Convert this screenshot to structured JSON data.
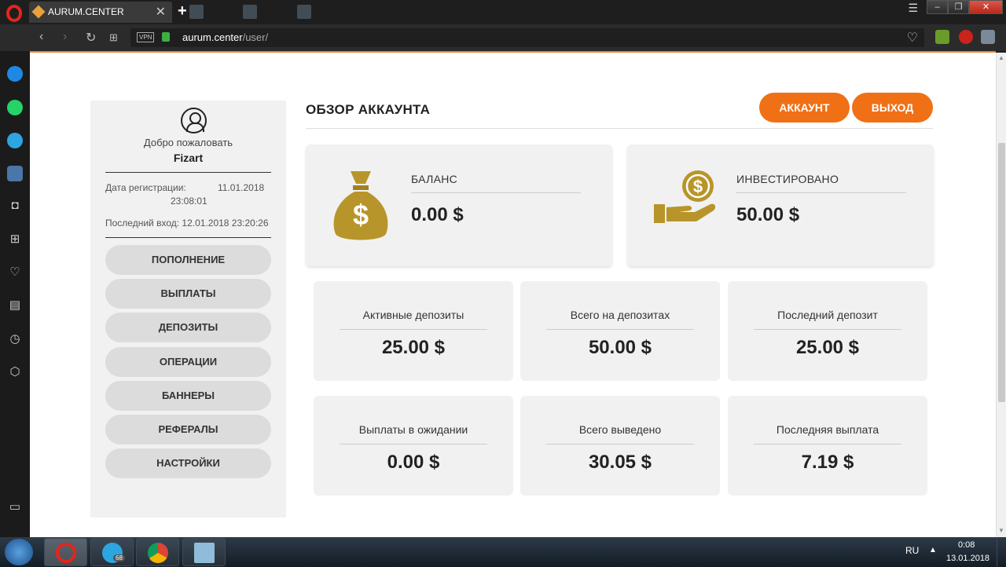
{
  "browser": {
    "tab_title": "AURUM.CENTER",
    "tab_close": "✕",
    "new_tab": "+",
    "vpn": "VPN",
    "url_domain": "aurum.center",
    "url_path": "/user/"
  },
  "profile": {
    "welcome": "Добро пожаловать",
    "username": "Fizart",
    "reg_label": "Дата регистрации:",
    "reg_date": "11.01.2018",
    "reg_time": "23:08:01",
    "last_login": "Последний вход: 12.01.2018 23:20:26"
  },
  "menu": [
    {
      "label": "ПОПОЛНЕНИЕ"
    },
    {
      "label": "ВЫПЛАТЫ"
    },
    {
      "label": "ДЕПОЗИТЫ"
    },
    {
      "label": "ОПЕРАЦИИ"
    },
    {
      "label": "БАННЕРЫ"
    },
    {
      "label": "РЕФЕРАЛЫ"
    },
    {
      "label": "НАСТРОЙКИ"
    }
  ],
  "header": {
    "title": "ОБЗОР АККАУНТА",
    "account_button": "АККАУНТ",
    "logout_button": "ВЫХОД"
  },
  "balance": {
    "label": "БАЛАНС",
    "value": "0.00 $"
  },
  "invested": {
    "label": "ИНВЕСТИРОВАНО",
    "value": "50.00 $"
  },
  "stats": [
    {
      "label": "Активные депозиты",
      "value": "25.00 $"
    },
    {
      "label": "Всего на депозитах",
      "value": "50.00 $"
    },
    {
      "label": "Последний депозит",
      "value": "25.00 $"
    },
    {
      "label": "Выплаты в ожидании",
      "value": "0.00 $"
    },
    {
      "label": "Всего выведено",
      "value": "30.05 $"
    },
    {
      "label": "Последняя выплата",
      "value": "7.19 $"
    }
  ],
  "taskbar": {
    "lang": "RU",
    "time": "0:08",
    "date": "13.01.2018",
    "telegram_badge": "68"
  },
  "colors": {
    "accent": "#f07016",
    "gold": "#b8952a",
    "card_bg": "#f1f1f1"
  }
}
